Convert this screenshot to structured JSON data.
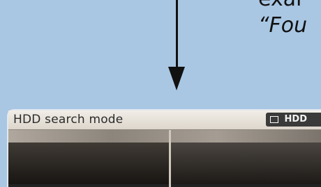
{
  "caption": {
    "line1": "exar",
    "line2": "“Fou"
  },
  "screen": {
    "title": "HDD search mode",
    "badge_label": "HDD"
  },
  "icons": {
    "arrow": "down-arrow-icon",
    "badge_icon": "hdd-icon"
  }
}
